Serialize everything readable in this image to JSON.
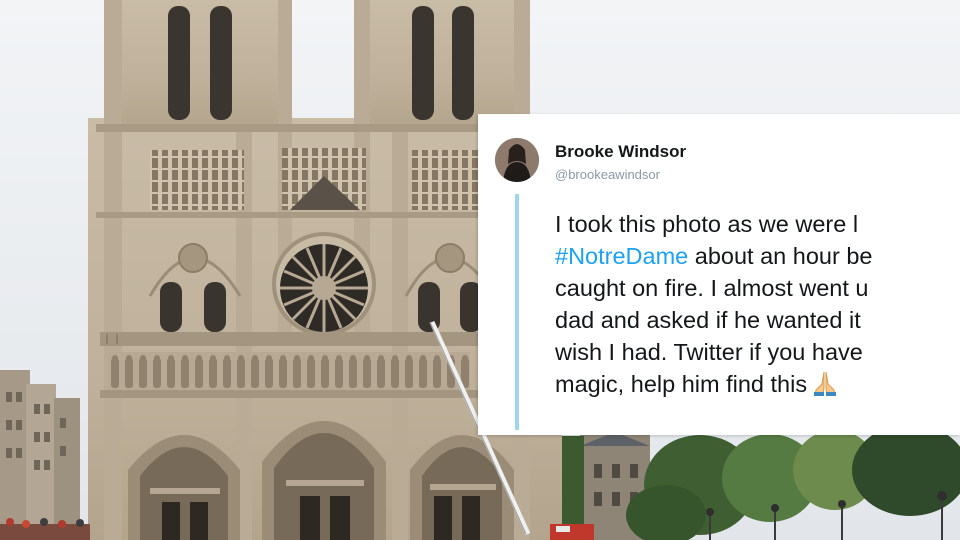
{
  "tweet": {
    "author_name": "Brooke Windsor",
    "author_handle": "@brookeawindsor",
    "lines": [
      {
        "text": "I took this photo as we were l"
      },
      {
        "hashtag": "#NotreDame",
        "text": " about an hour be"
      },
      {
        "text": "caught on fire. I almost went u"
      },
      {
        "text": "dad and asked if he wanted it"
      },
      {
        "text": "wish I had. Twitter if you have"
      },
      {
        "text": "magic, help him find this",
        "icon": "praying-hands-icon"
      }
    ]
  },
  "colors": {
    "hashtag": "#1da1f2",
    "thread_line": "#9fd3ef",
    "handle": "#8a98a6",
    "stone": "#c4b8a4",
    "sky": "#eef1f4",
    "trees": "#4b6b3a"
  },
  "icons": [
    "praying-hands-icon"
  ]
}
